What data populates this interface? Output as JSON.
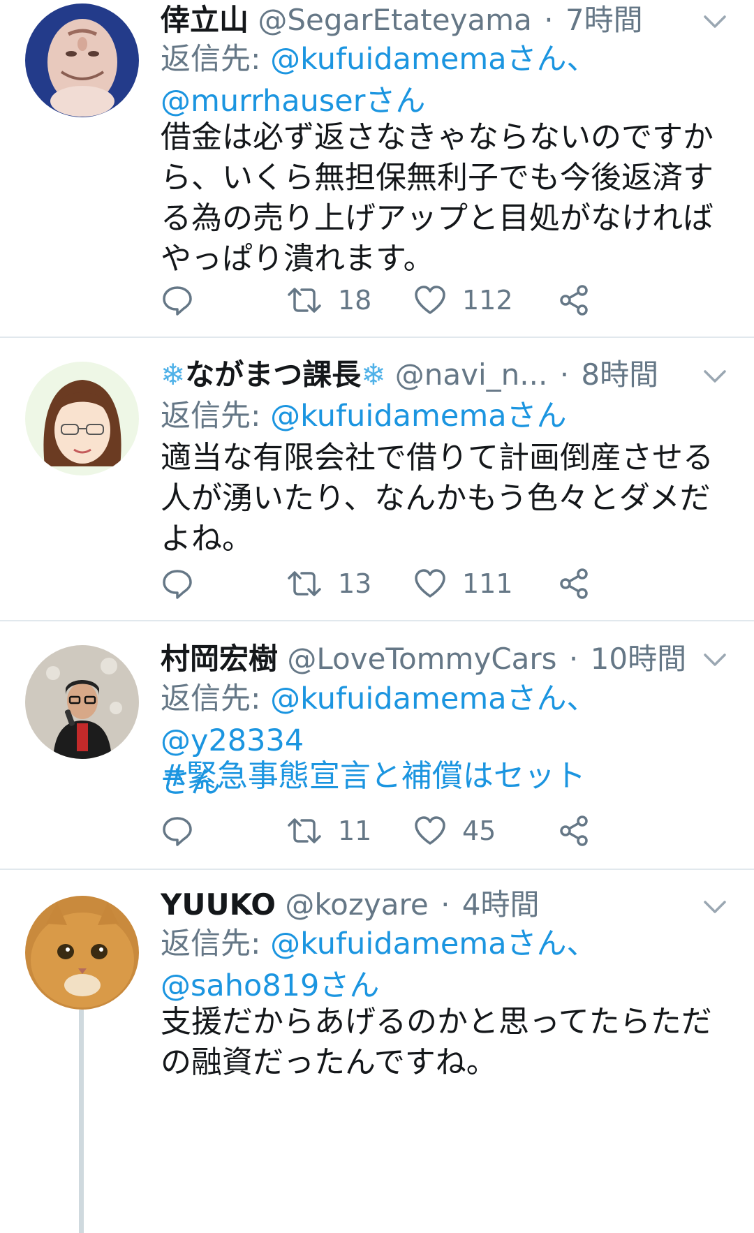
{
  "tweets": [
    {
      "display_name": "倖立山",
      "display_name_snow": false,
      "handle": "@SegarEtateyama",
      "separator": "·",
      "time": "7時間",
      "reply_label": "返信先: ",
      "reply_mentions_line1": "@kufuidamemaさん、",
      "reply_mentions_line2": "@murrhauserさん",
      "body": "借金は必ず返さなきゃならないのですから、いくら無担保無利子でも今後返済する為の売り上げアップと目処がなければやっぱり潰れます。",
      "retweets": "18",
      "likes": "112",
      "avatar_icon": "man-face-avatar-inverted"
    },
    {
      "display_name": "ながまつ課長",
      "snow_left": "❄",
      "snow_right": "❄",
      "handle": "@navi_n...",
      "separator": "·",
      "time": "8時間",
      "reply_label": "返信先: ",
      "reply_mentions_line1": "@kufuidamemaさん",
      "body": "適当な有限会社で借りて計画倒産させる人が湧いたり、なんかもう色々とダメだよね。",
      "retweets": "13",
      "likes": "111",
      "avatar_icon": "illustrated-woman-avatar"
    },
    {
      "display_name": "村岡宏樹",
      "handle": "@LoveTommyCars",
      "separator": "·",
      "time": "10時間",
      "reply_label": "返信先: ",
      "reply_mentions_line1": "@kufuidamemaさん、@y28334",
      "reply_mentions_line2": "さん",
      "body": "#緊急事態宣言と補償はセット",
      "retweets": "11",
      "likes": "45",
      "avatar_icon": "man-with-microphone-avatar"
    },
    {
      "display_name": "YUUKO",
      "handle": "@kozyare",
      "separator": "·",
      "time": "4時間",
      "reply_label": "返信先: ",
      "reply_mentions_line1": "@kufuidamemaさん、",
      "reply_mentions_line2": "@saho819さん",
      "body": "支援だからあげるのかと思ってたらただの融資だったんですね。",
      "avatar_icon": "cat-avatar"
    }
  ],
  "colors": {
    "text": "#14171a",
    "secondary": "#657786",
    "link": "#1b95e0",
    "divider": "#e1e8ed",
    "snowflake": "#4fb1e8"
  },
  "icons": {
    "reply": "reply-icon",
    "retweet": "retweet-icon",
    "like": "heart-icon",
    "share": "share-icon",
    "menu": "chevron-down-icon"
  }
}
